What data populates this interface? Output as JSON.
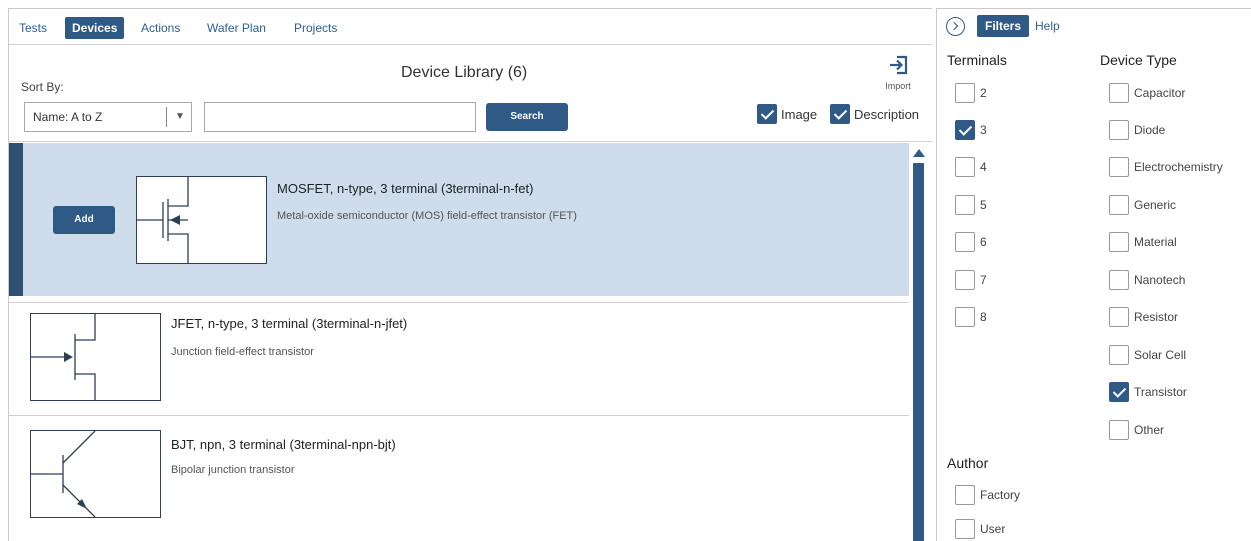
{
  "tabs": [
    "Tests",
    "Devices",
    "Actions",
    "Wafer Plan",
    "Projects"
  ],
  "active_tab": "Devices",
  "library": {
    "title": "Device Library (6)",
    "sort_label": "Sort By:",
    "sort_value": "Name: A to Z",
    "search_placeholder": "",
    "search_button": "Search",
    "import_label": "Import",
    "image_label": "Image",
    "image_checked": true,
    "description_label": "Description",
    "description_checked": true,
    "add_label": "Add"
  },
  "devices": [
    {
      "name": "MOSFET, n-type, 3 terminal (3terminal-n-fet)",
      "description": "Metal-oxide semiconductor (MOS) field-effect transistor (FET)",
      "selected": true
    },
    {
      "name": "JFET, n-type, 3 terminal (3terminal-n-jfet)",
      "description": "Junction field-effect transistor",
      "selected": false
    },
    {
      "name": "BJT, npn, 3 terminal (3terminal-npn-bjt)",
      "description": "Bipolar junction transistor",
      "selected": false
    }
  ],
  "filters": {
    "tab_filters": "Filters",
    "tab_help": "Help",
    "terminals_title": "Terminals",
    "terminals": [
      {
        "label": "2",
        "checked": false
      },
      {
        "label": "3",
        "checked": true
      },
      {
        "label": "4",
        "checked": false
      },
      {
        "label": "5",
        "checked": false
      },
      {
        "label": "6",
        "checked": false
      },
      {
        "label": "7",
        "checked": false
      },
      {
        "label": "8",
        "checked": false
      }
    ],
    "device_type_title": "Device Type",
    "device_types": [
      {
        "label": "Capacitor",
        "checked": false
      },
      {
        "label": "Diode",
        "checked": false
      },
      {
        "label": "Electrochemistry",
        "checked": false
      },
      {
        "label": "Generic",
        "checked": false
      },
      {
        "label": "Material",
        "checked": false
      },
      {
        "label": "Nanotech",
        "checked": false
      },
      {
        "label": "Resistor",
        "checked": false
      },
      {
        "label": "Solar Cell",
        "checked": false
      },
      {
        "label": "Transistor",
        "checked": true
      },
      {
        "label": "Other",
        "checked": false
      }
    ],
    "author_title": "Author",
    "authors": [
      {
        "label": "Factory",
        "checked": false
      },
      {
        "label": "User",
        "checked": false
      }
    ]
  },
  "colors": {
    "accent": "#2f5a86",
    "selected_row": "#cfdceb",
    "selected_bar": "#2f4f73"
  }
}
